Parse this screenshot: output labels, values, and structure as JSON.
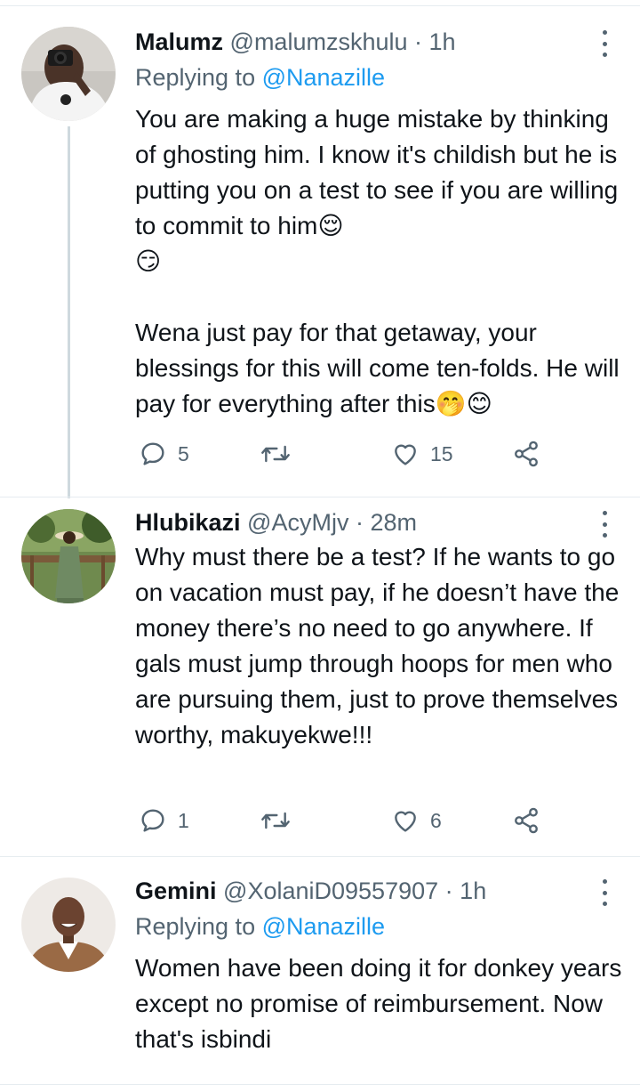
{
  "tweets": [
    {
      "name": "Malumz",
      "handle": "@malumzskhulu",
      "separator": "·",
      "time": "1h",
      "replying_label": "Replying to ",
      "replying_mention": "@Nanazille",
      "text": "You are making a huge mistake by thinking of ghosting him. I know it's childish but he is putting you on a test to see if you are willing to commit to him😌\n😏\n\nWena just pay for that getaway, your blessings for this will come ten-folds. He will pay for everything after this🤭😊",
      "replies": "5",
      "retweets": "",
      "likes": "15"
    },
    {
      "name": "Hlubikazi",
      "handle": "@AcyMjv",
      "separator": "·",
      "time": "28m",
      "text": "Why must there be a test? If he wants to go on vacation must pay, if he doesn’t have the money there’s no need to go anywhere. If gals must jump through hoops for men who are pursuing them, just to prove themselves worthy, makuyekwe!!!",
      "replies": "1",
      "retweets": "",
      "likes": "6"
    },
    {
      "name": "Gemini",
      "handle": "@XolaniD09557907",
      "separator": "·",
      "time": "1h",
      "replying_label": "Replying to ",
      "replying_mention": "@Nanazille",
      "text": "Women have been doing it for donkey years except no promise of reimbursement. Now that's isbindi"
    }
  ],
  "icons": {
    "reply": "reply-icon",
    "retweet": "retweet-icon",
    "like": "heart-icon",
    "share": "share-icon",
    "more": "more-icon"
  },
  "colors": {
    "link": "#1d9bf0",
    "secondary_text": "#536471",
    "primary_text": "#0f1419",
    "thread_line": "#cfd9de"
  }
}
